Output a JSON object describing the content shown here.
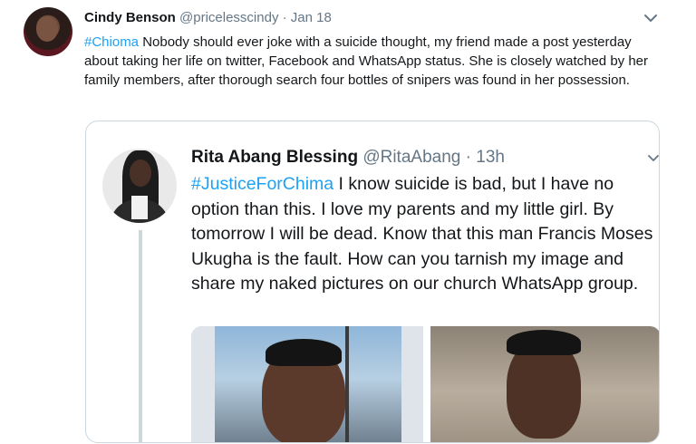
{
  "tweet": {
    "author_name": "Cindy Benson",
    "handle": "@pricelesscindy",
    "separator": "·",
    "date": "Jan 18",
    "hashtag": "#Chioma",
    "text": " Nobody should ever joke with a suicide thought, my friend made a post yesterday about taking her life on twitter, Facebook and WhatsApp status. She is closely watched by her family members, after thorough search four bottles of snipers was found in her possession."
  },
  "quoted_tweet": {
    "author_name": "Rita Abang Blessing",
    "handle": "@RitaAbang",
    "separator": "·",
    "time": "13h",
    "hashtag": "#JusticeForChima",
    "text": "  I know suicide is bad, but I have no option than this. I love my parents and my little girl. By tomorrow I will be dead. Know that this man Francis Moses Ukugha is the fault. How can you tarnish my image and share my naked pictures on our church WhatsApp group."
  },
  "icons": {
    "tweet_menu": "chevron-down-icon",
    "quote_menu": "chevron-down-icon"
  },
  "colors": {
    "link": "#1da1f2",
    "secondary_text": "#657786",
    "border": "#ccd6dd"
  }
}
